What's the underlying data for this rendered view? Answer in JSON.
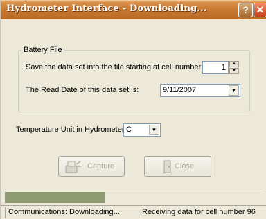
{
  "window": {
    "title": "Hydrometer Interface - Downloading...",
    "help_label": "?",
    "close_label": "✕"
  },
  "battery_group": {
    "legend": "Battery File",
    "save_label": "Save the data set into the file starting at cell number",
    "cell_number": "1",
    "read_date_label": "The Read Date of this data set is:",
    "read_date": "9/11/2007"
  },
  "temperature": {
    "label": "Temperature Unit in Hydrometer:",
    "unit": "C"
  },
  "buttons": {
    "capture_label": "Capture",
    "close_label": "Close"
  },
  "progress": {
    "fraction": 0.39
  },
  "status": {
    "left": "Communications: Downloading...",
    "right": "Receiving data for cell number 96"
  },
  "colors": {
    "title_bar": "#c8782f",
    "progress_fill": "#8f9b73",
    "background": "#ece9d8"
  }
}
